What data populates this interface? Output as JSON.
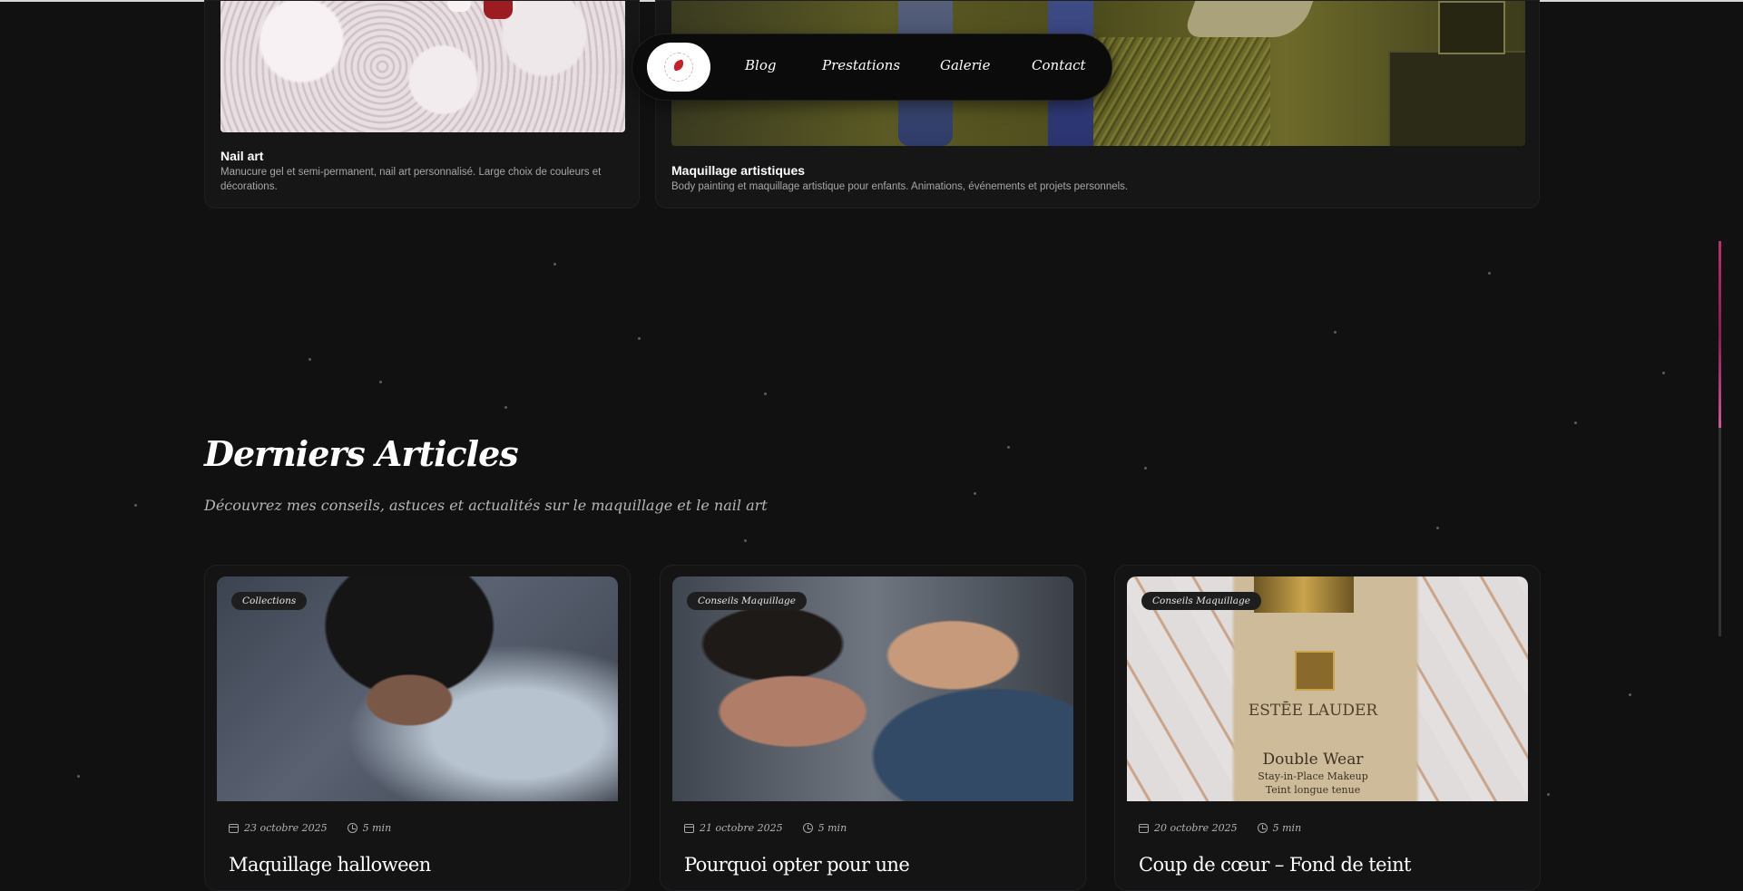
{
  "nav": {
    "logo_alt": "logo",
    "links": [
      "Blog",
      "Prestations",
      "Galerie",
      "Contact"
    ]
  },
  "services": [
    {
      "title": "Nail art",
      "description": "Manucure gel et semi-permanent, nail art personnalisé. Large choix de couleurs et décorations."
    },
    {
      "title": "Maquillage artistiques",
      "description": "Body painting et maquillage artistique pour enfants. Animations, événements et projets personnels."
    }
  ],
  "articles_section": {
    "title": "Derniers Articles",
    "subtitle": "Découvrez mes conseils, astuces et actualités sur le maquillage et le nail art"
  },
  "articles": [
    {
      "category": "Collections",
      "date": "23 octobre 2025",
      "read_time": "5 min",
      "title": "Maquillage halloween"
    },
    {
      "category": "Conseils Maquillage",
      "date": "21 octobre 2025",
      "read_time": "5 min",
      "title": "Pourquoi opter pour une"
    },
    {
      "category": "Conseils Maquillage",
      "date": "20 octobre 2025",
      "read_time": "5 min",
      "title": "Coup de cœur – Fond de teint"
    }
  ],
  "product_image_text": {
    "brand": "ESTĒE LAUDER",
    "line1": "Double Wear",
    "line2": "Stay-in-Place Makeup",
    "line3": "Teint longue tenue"
  },
  "colors": {
    "background": "#111112",
    "accent": "#c02e6e"
  }
}
